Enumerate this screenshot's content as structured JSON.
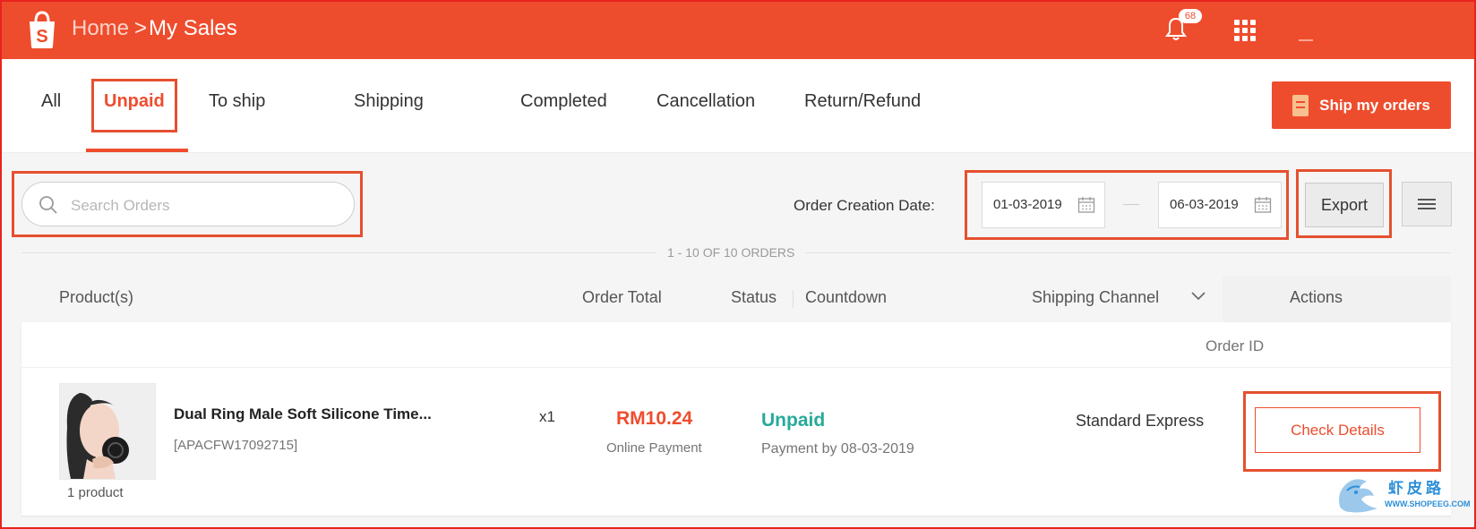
{
  "header": {
    "breadcrumb_home": "Home",
    "breadcrumb_separator": ">",
    "breadcrumb_current": "My Sales",
    "notification_count": "68",
    "bg_color": "#ee4d2d"
  },
  "tabs": [
    {
      "label": "All",
      "active": false
    },
    {
      "label": "Unpaid",
      "active": true
    },
    {
      "label": "To ship",
      "active": false
    },
    {
      "label": "Shipping",
      "active": false
    },
    {
      "label": "Completed",
      "active": false
    },
    {
      "label": "Cancellation",
      "active": false
    },
    {
      "label": "Return/Refund",
      "active": false
    }
  ],
  "ship_button": {
    "label": "Ship my orders",
    "icon": "document-icon"
  },
  "filters": {
    "search_placeholder": "Search Orders",
    "search_value": "",
    "date_label": "Order Creation Date:",
    "date_from": "01-03-2019",
    "date_to": "06-03-2019",
    "export_label": "Export"
  },
  "results": {
    "count_text": "1 - 10 OF 10 ORDERS"
  },
  "table": {
    "headers": {
      "product": "Product(s)",
      "order_total": "Order Total",
      "status": "Status",
      "countdown": "Countdown",
      "shipping_channel": "Shipping Channel",
      "actions": "Actions"
    },
    "order_id_label": "Order ID"
  },
  "order": {
    "product_name": "Dual Ring Male Soft Silicone Time...",
    "sku": "[APACFW17092715]",
    "product_count": "1 product",
    "quantity": "x1",
    "total": "RM10.24",
    "payment_method": "Online Payment",
    "status": "Unpaid",
    "payment_due": "Payment by 08-03-2019",
    "shipping_channel": "Standard Express",
    "action_label": "Check Details"
  },
  "watermark": {
    "chinese": "虾皮路",
    "url": "WWW.SHOPEEG.COM"
  },
  "colors": {
    "accent": "#ee4d2d",
    "status_unpaid": "#26aa99",
    "highlight": "#e5502f"
  }
}
